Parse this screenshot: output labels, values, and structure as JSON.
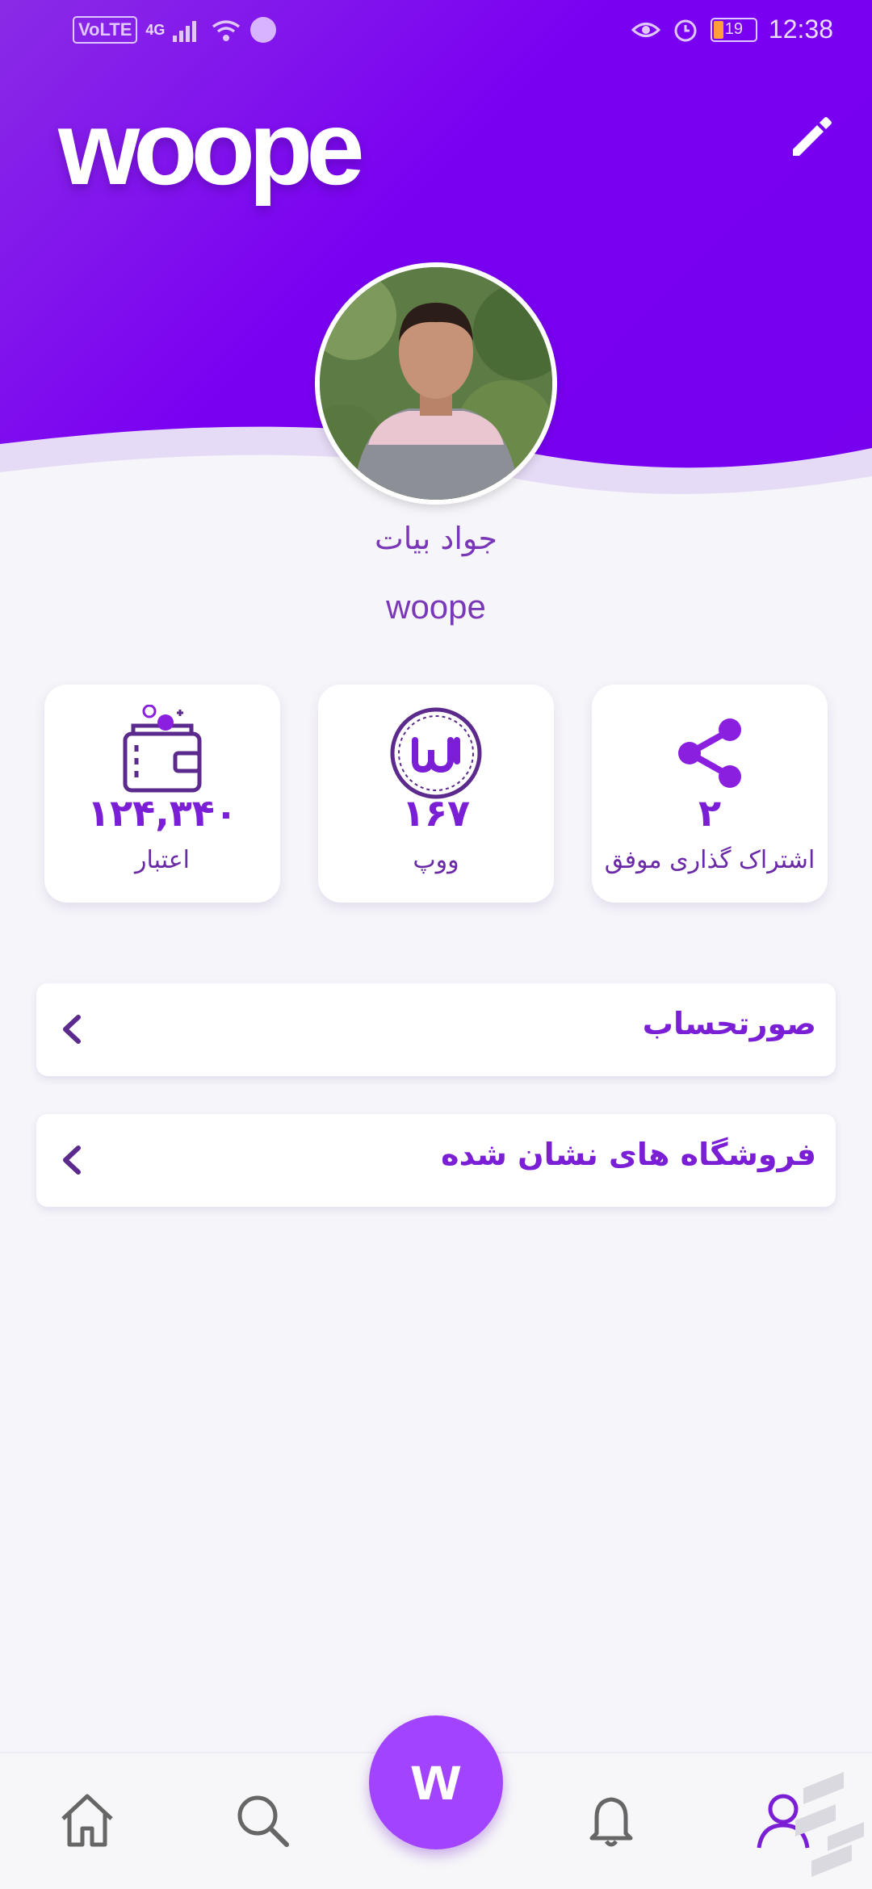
{
  "status_bar": {
    "network": "VoLTE",
    "signal": "4G",
    "battery": "19",
    "time": "12:38"
  },
  "header": {
    "logo": "woope"
  },
  "profile": {
    "name": "جواد بیات",
    "username": "woope"
  },
  "stats": [
    {
      "value": "۱۲۴,۳۴۰",
      "label": "اعتبار",
      "icon": "wallet-icon"
    },
    {
      "value": "۱۶۷",
      "label": "ووپ",
      "icon": "woope-coin-icon"
    },
    {
      "value": "۲",
      "label": "اشتراک گذاری موفق",
      "icon": "share-icon"
    }
  ],
  "menu": [
    {
      "label": "صورتحساب"
    },
    {
      "label": "فروشگاه های نشان شده"
    }
  ],
  "bottom_nav": {
    "fab_glyph": "w",
    "items": [
      "home-icon",
      "search-icon",
      "bell-icon",
      "profile-icon"
    ]
  },
  "colors": {
    "primary": "#7700ef",
    "accent": "#a243ff",
    "text_purple": "#7b1fd6",
    "background": "#f6f5fa"
  }
}
